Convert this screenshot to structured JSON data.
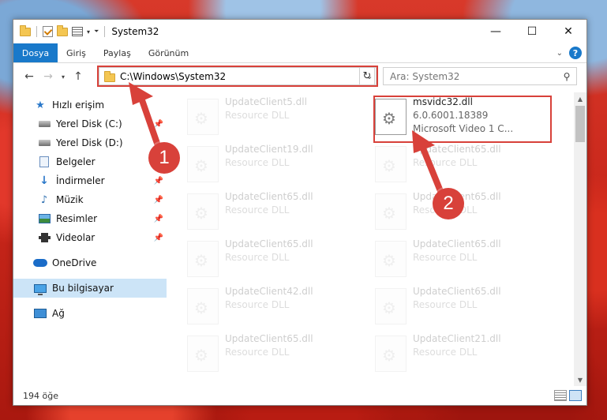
{
  "window": {
    "title": "System32",
    "controls": {
      "minimize": "—",
      "maximize": "☐",
      "close": "✕"
    }
  },
  "ribbon": {
    "tabs": [
      {
        "label": "Dosya",
        "active": true
      },
      {
        "label": "Giriş"
      },
      {
        "label": "Paylaş"
      },
      {
        "label": "Görünüm"
      }
    ],
    "help": "?"
  },
  "nav": {
    "back": "←",
    "forward": "→",
    "up": "↑",
    "address": "C:\\Windows\\System32",
    "search_placeholder": "Ara: System32"
  },
  "sidebar": {
    "items": [
      {
        "label": "Hızlı erişim",
        "icon": "star-icon"
      },
      {
        "label": "Yerel Disk (C:)",
        "icon": "drive-icon",
        "pinned": true
      },
      {
        "label": "Yerel Disk (D:)",
        "icon": "drive-icon"
      },
      {
        "label": "Belgeler",
        "icon": "documents-icon"
      },
      {
        "label": "İndirmeler",
        "icon": "download-icon",
        "pinned": true
      },
      {
        "label": "Müzik",
        "icon": "music-icon",
        "pinned": true
      },
      {
        "label": "Resimler",
        "icon": "pictures-icon",
        "pinned": true
      },
      {
        "label": "Videolar",
        "icon": "videos-icon",
        "pinned": true
      },
      {
        "label": "OneDrive",
        "icon": "onedrive-icon"
      },
      {
        "label": "Bu bilgisayar",
        "icon": "computer-icon",
        "selected": true
      },
      {
        "label": "Ağ",
        "icon": "network-icon"
      }
    ]
  },
  "files": {
    "left": [
      {
        "name": "UpdateClient5.dll",
        "type": "Resource DLL"
      },
      {
        "name": "UpdateClient19.dll",
        "type": "Resource DLL"
      },
      {
        "name": "UpdateClient65.dll",
        "type": "Resource DLL"
      },
      {
        "name": "UpdateClient65.dll",
        "type": "Resource DLL"
      },
      {
        "name": "UpdateClient42.dll",
        "type": "Resource DLL"
      },
      {
        "name": "UpdateClient65.dll",
        "type": "Resource DLL"
      }
    ],
    "right": [
      {
        "name": "msvidc32.dll",
        "version": "6.0.6001.18389",
        "desc": "Microsoft Video 1 C..."
      },
      {
        "name": "UpdateClient65.dll",
        "type": "Resource DLL"
      },
      {
        "name": "UpdateClient65.dll",
        "type": "Resource DLL"
      },
      {
        "name": "UpdateClient65.dll",
        "type": "Resource DLL"
      },
      {
        "name": "UpdateClient65.dll",
        "type": "Resource DLL"
      },
      {
        "name": "UpdateClient21.dll",
        "type": "Resource DLL"
      }
    ]
  },
  "status": {
    "count": "194 öğe"
  },
  "callouts": {
    "one": "1",
    "two": "2"
  },
  "colors": {
    "accent": "#1979ca",
    "highlight": "#d8413a",
    "selected": "#cce4f7"
  }
}
